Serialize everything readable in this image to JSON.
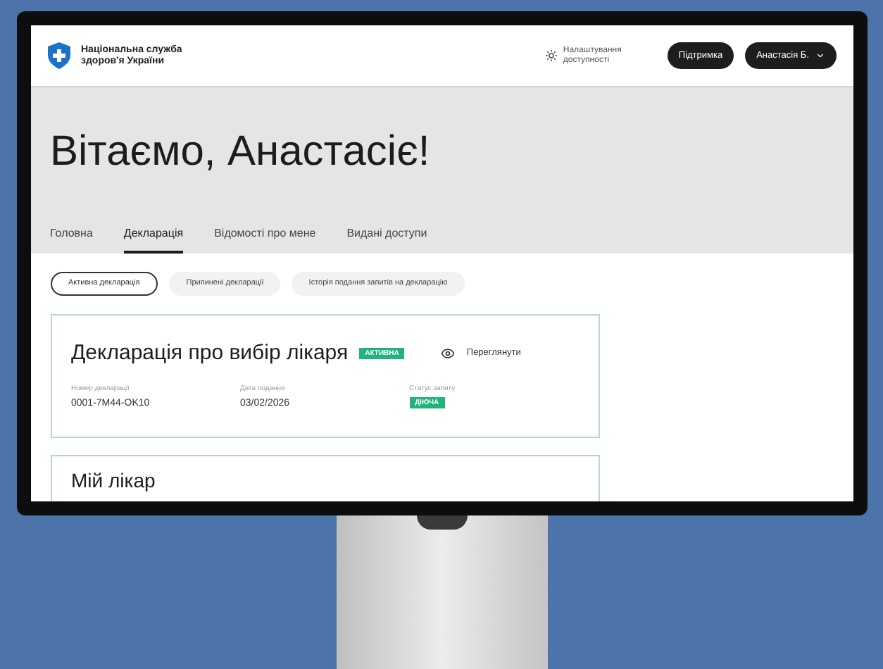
{
  "header": {
    "logo_text": [
      "Національна служба",
      "здоров'я України"
    ],
    "accessibility": "Налаштування доступності",
    "support_button": "Підтримка",
    "user_button": "Анастасія Б."
  },
  "greeting": "Вітаємо, Анастасіє!",
  "tabs": [
    {
      "label": "Головна",
      "selected": false
    },
    {
      "label": "Декларація",
      "selected": true
    },
    {
      "label": "Відомості про мене",
      "selected": false
    },
    {
      "label": "Видані доступи",
      "selected": false
    }
  ],
  "filters": [
    {
      "label": "Активна декларація",
      "selected": true
    },
    {
      "label": "Припинені декларації",
      "selected": false
    },
    {
      "label": "Історія подання запитів на декларацію",
      "selected": false
    }
  ],
  "declaration_card": {
    "title": "Декларація про вибір лікаря",
    "badge": "АКТИВНА",
    "view_link": "Переглянути",
    "fields": [
      {
        "label": "Номер декларації",
        "value": "0001-7M44-OK10",
        "kind": "text"
      },
      {
        "label": "Дата подання",
        "value": "03/02/2026",
        "kind": "text"
      },
      {
        "label": "Статус запиту",
        "value": "ДІЮЧА",
        "kind": "badge"
      }
    ]
  },
  "doctor_card": {
    "title": "Мій лікар"
  }
}
